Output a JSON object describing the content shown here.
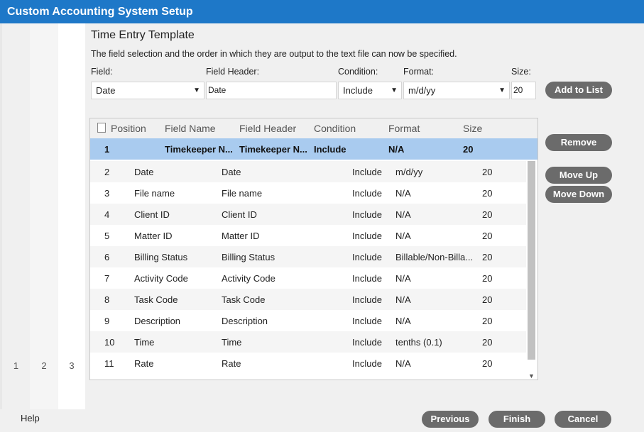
{
  "window": {
    "title": "Custom Accounting System Setup"
  },
  "steps": [
    "1",
    "2",
    "3"
  ],
  "page": {
    "heading": "Time Entry Template",
    "description": "The field selection and the order in which they are output to the text file can now be specified."
  },
  "form": {
    "field_label": "Field:",
    "field_value": "Date",
    "header_label": "Field Header:",
    "header_value": "Date",
    "condition_label": "Condition:",
    "condition_value": "Include",
    "format_label": "Format:",
    "format_value": "m/d/yy",
    "size_label": "Size:",
    "size_value": "20",
    "add_button": "Add to List"
  },
  "grid": {
    "columns": [
      "Position",
      "Field Name",
      "Field Header",
      "Condition",
      "Format",
      "Size"
    ],
    "rows": [
      {
        "position": "1",
        "name": "Timekeeper N...",
        "header": "Timekeeper N...",
        "condition": "Include",
        "format": "N/A",
        "size": "20"
      },
      {
        "position": "2",
        "name": "Date",
        "header": "Date",
        "condition": "Include",
        "format": "m/d/yy",
        "size": "20"
      },
      {
        "position": "3",
        "name": "File name",
        "header": "File name",
        "condition": "Include",
        "format": "N/A",
        "size": "20"
      },
      {
        "position": "4",
        "name": "Client ID",
        "header": "Client ID",
        "condition": "Include",
        "format": "N/A",
        "size": "20"
      },
      {
        "position": "5",
        "name": "Matter ID",
        "header": "Matter ID",
        "condition": "Include",
        "format": "N/A",
        "size": "20"
      },
      {
        "position": "6",
        "name": "Billing Status",
        "header": "Billing Status",
        "condition": "Include",
        "format": "Billable/Non-Billa...",
        "size": "20"
      },
      {
        "position": "7",
        "name": "Activity Code",
        "header": "Activity Code",
        "condition": "Include",
        "format": "N/A",
        "size": "20"
      },
      {
        "position": "8",
        "name": "Task Code",
        "header": "Task Code",
        "condition": "Include",
        "format": "N/A",
        "size": "20"
      },
      {
        "position": "9",
        "name": "Description",
        "header": "Description",
        "condition": "Include",
        "format": "N/A",
        "size": "20"
      },
      {
        "position": "10",
        "name": "Time",
        "header": "Time",
        "condition": "Include",
        "format": "tenths (0.1)",
        "size": "20"
      },
      {
        "position": "11",
        "name": "Rate",
        "header": "Rate",
        "condition": "Include",
        "format": "N/A",
        "size": "20"
      }
    ]
  },
  "side_buttons": {
    "remove": "Remove",
    "move_up": "Move Up",
    "move_down": "Move Down"
  },
  "footer": {
    "help": "Help",
    "previous": "Previous",
    "finish": "Finish",
    "cancel": "Cancel"
  },
  "colors": {
    "titlebar": "#1e78c8",
    "button": "#6b6b6b",
    "selected_row": "#a9cbef"
  }
}
